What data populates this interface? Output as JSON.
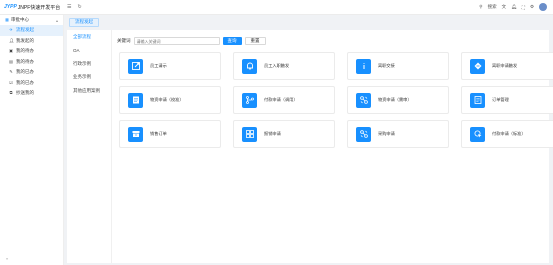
{
  "header": {
    "logo_mark": "JYPP",
    "logo_text": "JNPF快速开发平台",
    "search_label": "搜索"
  },
  "sidebar": {
    "group_label": "审批中心",
    "items": [
      {
        "label": "流程发起",
        "icon": "send-icon",
        "active": true
      },
      {
        "label": "我发起的",
        "icon": "user-icon",
        "active": false
      },
      {
        "label": "我的待办",
        "icon": "inbox-icon",
        "active": false
      },
      {
        "label": "我的待办",
        "icon": "list-icon",
        "active": false
      },
      {
        "label": "我的已办",
        "icon": "edit-icon",
        "active": false
      },
      {
        "label": "我的已办",
        "icon": "check-icon",
        "active": false
      },
      {
        "label": "抄送我的",
        "icon": "copy-icon",
        "active": false
      }
    ]
  },
  "tabs": [
    {
      "label": "流程发起"
    }
  ],
  "categories": [
    {
      "label": "全部流程",
      "active": true
    },
    {
      "label": "OA",
      "active": false
    },
    {
      "label": "行政示例",
      "active": false
    },
    {
      "label": "业务示例",
      "active": false
    },
    {
      "label": "其他应用案例",
      "active": false
    }
  ],
  "search": {
    "label": "关键词",
    "placeholder": "请输入关键词",
    "query_label": "查询",
    "reset_label": "重置"
  },
  "flows": [
    {
      "label": "员工请示",
      "icon": "external-link-icon"
    },
    {
      "label": "员工入职触发",
      "icon": "bell-icon"
    },
    {
      "label": "离职交接",
      "icon": "info-icon"
    },
    {
      "label": "离职申请触发",
      "icon": "shuffle-icon"
    },
    {
      "label": "物资申请（校准）",
      "icon": "document-icon"
    },
    {
      "label": "付款申请（调用）",
      "icon": "branch-icon"
    },
    {
      "label": "物资申请（需审）",
      "icon": "node-icon"
    },
    {
      "label": "订单管理",
      "icon": "form-icon"
    },
    {
      "label": "销售订单",
      "icon": "archive-icon"
    },
    {
      "label": "报销申请",
      "icon": "grid-icon"
    },
    {
      "label": "采购申请",
      "icon": "node-icon"
    },
    {
      "label": "付款申请（标准）",
      "icon": "cursor-icon"
    }
  ],
  "colors": {
    "accent": "#1890ff"
  }
}
